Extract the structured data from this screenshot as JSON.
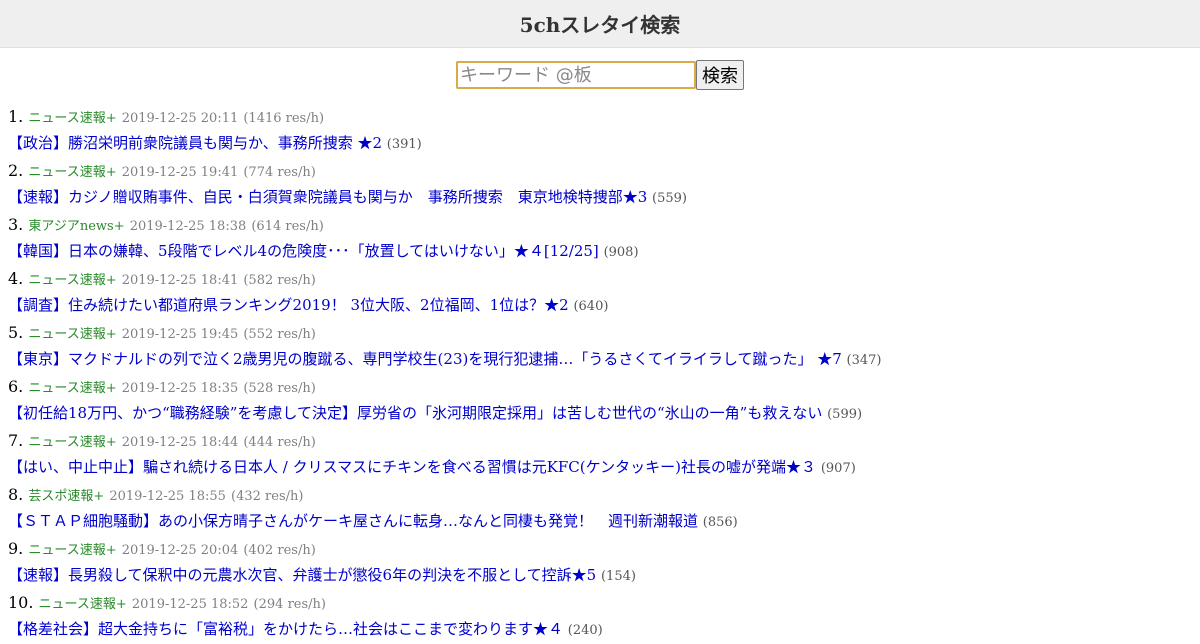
{
  "header": {
    "title": "5chスレタイ検索"
  },
  "search": {
    "placeholder": "キーワード @板",
    "value": "",
    "button_label": "検索"
  },
  "results": [
    {
      "rank": "1.",
      "board": "ニュース速報+",
      "datetime": "2019-12-25 20:11",
      "speed": "(1416 res/h)",
      "title": "【政治】勝沼栄明前衆院議員も関与か、事務所捜索 ★2",
      "count": "(391)"
    },
    {
      "rank": "2.",
      "board": "ニュース速報+",
      "datetime": "2019-12-25 19:41",
      "speed": "(774 res/h)",
      "title": "【速報】カジノ贈収賄事件、自民・白須賀衆院議員も関与か　事務所捜索　東京地検特捜部★3",
      "count": "(559)"
    },
    {
      "rank": "3.",
      "board": "東アジアnews+",
      "datetime": "2019-12-25 18:38",
      "speed": "(614 res/h)",
      "title": "【韓国】日本の嫌韓、5段階でレベル4の危険度･･･「放置してはいけない」★４[12/25]",
      "count": "(908)"
    },
    {
      "rank": "4.",
      "board": "ニュース速報+",
      "datetime": "2019-12-25 18:41",
      "speed": "(582 res/h)",
      "title": "【調査】住み続けたい都道府県ランキング2019！ 3位大阪、2位福岡、1位は？★2",
      "count": "(640)"
    },
    {
      "rank": "5.",
      "board": "ニュース速報+",
      "datetime": "2019-12-25 19:45",
      "speed": "(552 res/h)",
      "title": "【東京】マクドナルドの列で泣く2歳男児の腹蹴る、専門学校生(23)を現行犯逮捕…「うるさくてイライラして蹴った」 ★7",
      "count": "(347)"
    },
    {
      "rank": "6.",
      "board": "ニュース速報+",
      "datetime": "2019-12-25 18:35",
      "speed": "(528 res/h)",
      "title": "【初任給18万円、かつ“職務経験”を考慮して決定】厚労省の「氷河期限定採用」は苦しむ世代の“氷山の一角”も救えない",
      "count": "(599)"
    },
    {
      "rank": "7.",
      "board": "ニュース速報+",
      "datetime": "2019-12-25 18:44",
      "speed": "(444 res/h)",
      "title": "【はい、中止中止】騙され続ける日本人 / クリスマスにチキンを食べる習慣は元KFC(ケンタッキー)社長の嘘が発端★３",
      "count": "(907)"
    },
    {
      "rank": "8.",
      "board": "芸スポ速報+",
      "datetime": "2019-12-25 18:55",
      "speed": "(432 res/h)",
      "title": "【ＳＴＡＰ細胞騒動】あの小保方晴子さんがケーキ屋さんに転身…なんと同棲も発覚！　週刊新潮報道",
      "count": "(856)"
    },
    {
      "rank": "9.",
      "board": "ニュース速報+",
      "datetime": "2019-12-25 20:04",
      "speed": "(402 res/h)",
      "title": "【速報】長男殺して保釈中の元農水次官、弁護士が懲役6年の判決を不服として控訴★5",
      "count": "(154)"
    },
    {
      "rank": "10.",
      "board": "ニュース速報+",
      "datetime": "2019-12-25 18:52",
      "speed": "(294 res/h)",
      "title": "【格差社会】超大金持ちに「富裕税」をかけたら…社会はここまで変わります★４",
      "count": "(240)"
    }
  ]
}
